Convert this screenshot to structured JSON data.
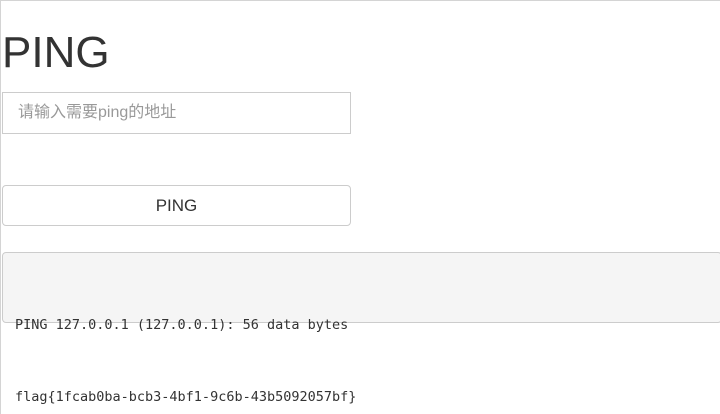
{
  "page": {
    "title": "PING"
  },
  "form": {
    "address_placeholder": "请输入需要ping的地址",
    "address_value": "",
    "submit_label": "PING"
  },
  "output": {
    "lines": [
      "PING 127.0.0.1 (127.0.0.1): 56 data bytes",
      "flag{1fcab0ba-bcb3-4bf1-9c6b-43b5092057bf}"
    ]
  },
  "colors": {
    "text": "#333333",
    "placeholder": "#999999",
    "border": "#cccccc",
    "output_background": "#f5f5f5"
  }
}
